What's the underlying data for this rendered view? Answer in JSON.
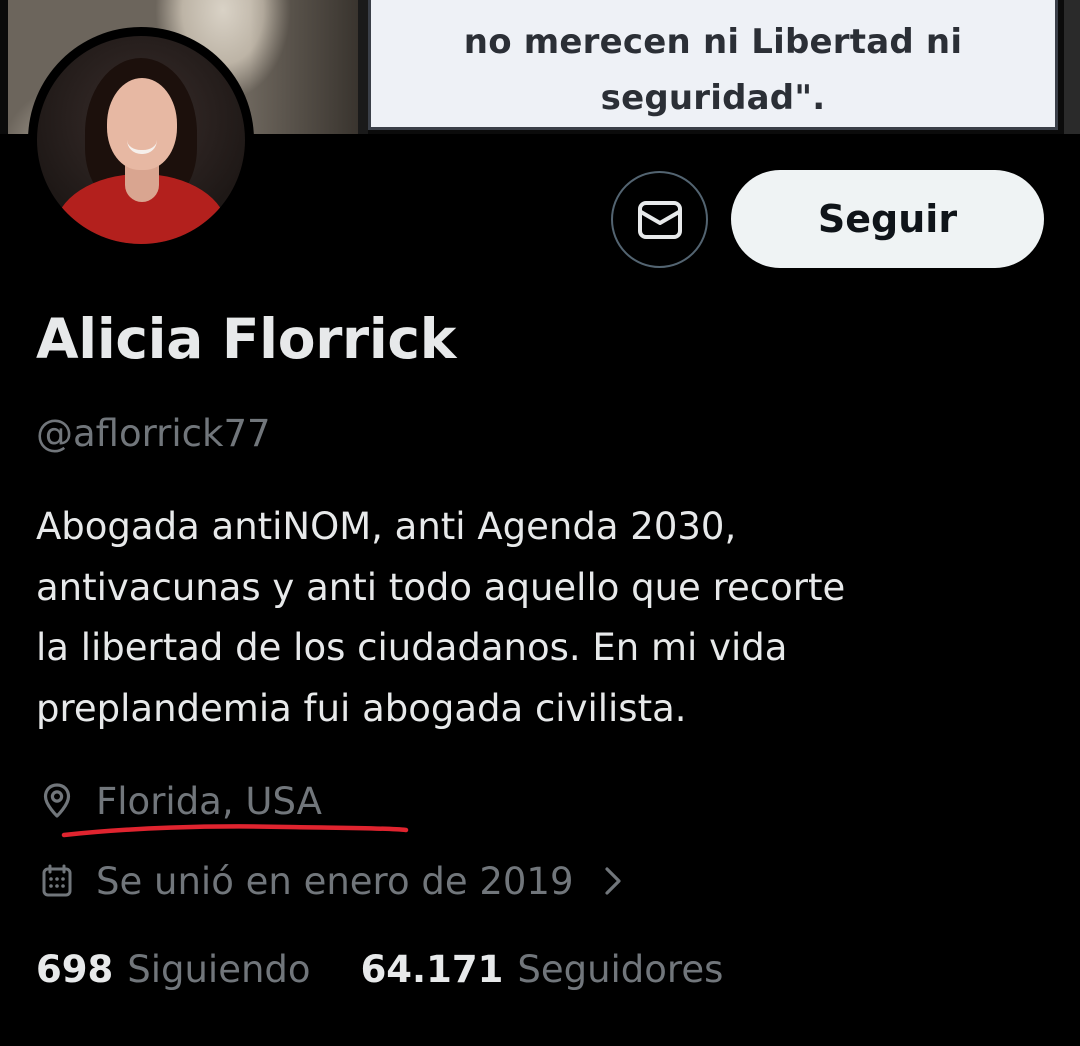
{
  "banner": {
    "quote_lines": [
      "no merecen ni Libertad ni",
      "seguridad\"."
    ]
  },
  "profile": {
    "name": "Alicia Florrick",
    "handle": "@aflorrick77",
    "bio_lines": [
      "Abogada antiNOM, anti Agenda 2030,",
      "antivacunas y anti todo aquello que recorte",
      "la libertad de los ciudadanos. En mi vida",
      "preplandemia fui abogada civilista."
    ],
    "location": "Florida, USA",
    "joined": "Se unió en enero de 2019"
  },
  "actions": {
    "follow_label": "Seguir",
    "message_icon": "envelope-icon"
  },
  "stats": {
    "following_count": "698",
    "following_label": "Siguiendo",
    "followers_count": "64.171",
    "followers_label": "Seguidores"
  },
  "colors": {
    "background": "#000000",
    "primary_text": "#e7e9ea",
    "secondary_text": "#71767b",
    "follow_button_bg": "#eff3f4",
    "underline_annotation": "#e0242f"
  }
}
